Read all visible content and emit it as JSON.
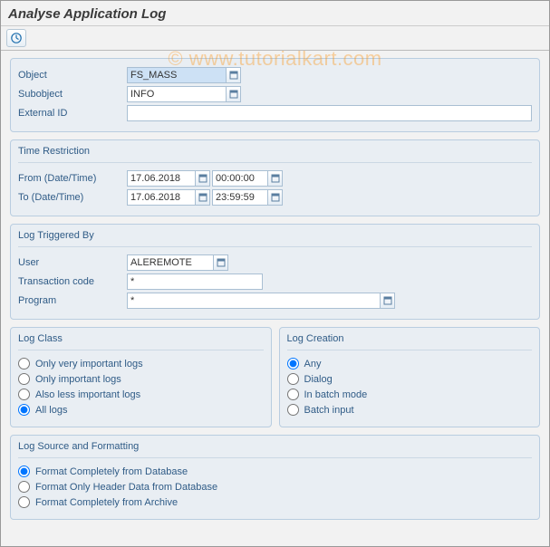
{
  "title": "Analyse Application Log",
  "watermark": "© www.tutorialkart.com",
  "topFields": {
    "objectLabel": "Object",
    "objectValue": "FS_MASS",
    "subobjectLabel": "Subobject",
    "subobjectValue": "INFO",
    "externalIdLabel": "External ID",
    "externalIdValue": ""
  },
  "timeRestriction": {
    "title": "Time Restriction",
    "fromLabel": "From (Date/Time)",
    "fromDate": "17.06.2018",
    "fromTime": "00:00:00",
    "toLabel": "To (Date/Time)",
    "toDate": "17.06.2018",
    "toTime": "23:59:59"
  },
  "triggeredBy": {
    "title": "Log Triggered By",
    "userLabel": "User",
    "userValue": "ALEREMOTE",
    "tcodeLabel": "Transaction code",
    "tcodeValue": "*",
    "programLabel": "Program",
    "programValue": "*"
  },
  "logClass": {
    "title": "Log Class",
    "options": [
      "Only very important logs",
      "Only important logs",
      "Also less important logs",
      "All logs"
    ],
    "selected": 3
  },
  "logCreation": {
    "title": "Log Creation",
    "options": [
      "Any",
      "Dialog",
      "In batch mode",
      "Batch input"
    ],
    "selected": 0
  },
  "logSource": {
    "title": "Log Source and Formatting",
    "options": [
      "Format Completely from Database",
      "Format Only Header Data from Database",
      "Format Completely from Archive"
    ],
    "selected": 0
  }
}
